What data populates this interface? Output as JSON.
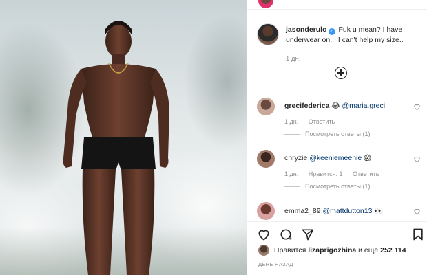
{
  "post": {
    "author": "jasonderulo",
    "verified_mark": "✓",
    "caption": "Fuk u mean? I have underwear on... I can't help my size..",
    "time": "1 дн."
  },
  "comments": [
    {
      "username": "grecifederica",
      "emoji": "😂",
      "mention": "@maria.greci",
      "time": "1 дн.",
      "likes": "",
      "reply_label": "Ответить",
      "view_replies": "Посмотреть ответы (1)"
    },
    {
      "username": "chryzie",
      "emoji": "😱",
      "mention": "@keeniemeenie",
      "time": "1 дн.",
      "likes": "Нравится: 1",
      "reply_label": "Ответить",
      "view_replies": "Посмотреть ответы (1)"
    },
    {
      "username": "emma2_89",
      "emoji": "👀",
      "mention": "@mattdutton13",
      "time": "",
      "likes": "",
      "reply_label": "",
      "view_replies": ""
    }
  ],
  "likes_line": {
    "prefix": "Нравится",
    "user": "lizaprigozhina",
    "suffix": "и ещё",
    "count": "252 114"
  },
  "posted_label": "ДЕНЬ НАЗАД",
  "icons": [
    "heart-icon",
    "comment-icon",
    "share-icon",
    "bookmark-icon",
    "add-icon",
    "verified-icon"
  ],
  "colors": {
    "link": "#003569",
    "verified": "#3897f0",
    "muted": "#8e8e8e",
    "text": "#262626"
  }
}
